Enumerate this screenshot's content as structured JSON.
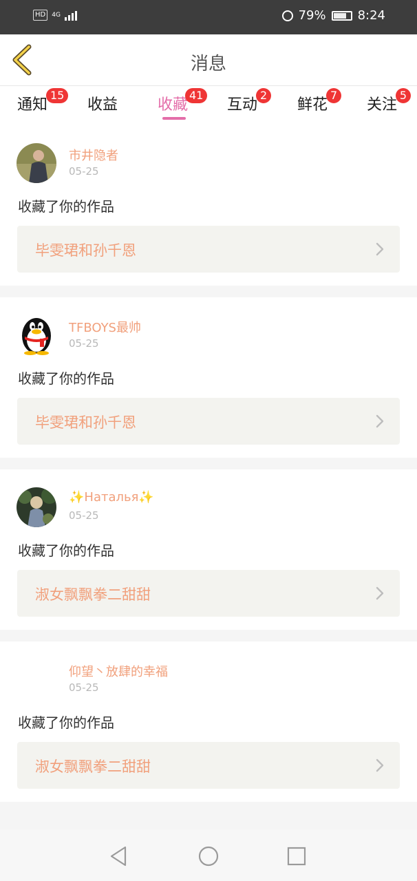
{
  "status_bar": {
    "hd": "HD",
    "network": "4G",
    "battery_pct": "79%",
    "time": "8:24"
  },
  "header": {
    "title": "消息"
  },
  "tabs": [
    {
      "label": "通知",
      "badge": "15"
    },
    {
      "label": "收益",
      "badge": ""
    },
    {
      "label": "收藏",
      "badge": "41",
      "active": true
    },
    {
      "label": "互动",
      "badge": "2"
    },
    {
      "label": "鲜花",
      "badge": "7"
    },
    {
      "label": "关注",
      "badge": "5"
    }
  ],
  "notifications": [
    {
      "user": "市井隐者",
      "date": "05-25",
      "message": "收藏了你的作品",
      "work": "毕雯珺和孙千恩"
    },
    {
      "user": "TFBOYS最帅",
      "date": "05-25",
      "message": "收藏了你的作品",
      "work": "毕雯珺和孙千恩"
    },
    {
      "user": "✨Наталья✨",
      "date": "05-25",
      "message": "收藏了你的作品",
      "work": "淑女飘飘拳二甜甜"
    },
    {
      "user": "仰望丶放肆的幸福",
      "date": "05-25",
      "message": "收藏了你的作品",
      "work": "淑女飘飘拳二甜甜"
    }
  ],
  "colors": {
    "accent": "#e46ea9",
    "badge": "#ef3535",
    "name": "#f1a07c"
  }
}
